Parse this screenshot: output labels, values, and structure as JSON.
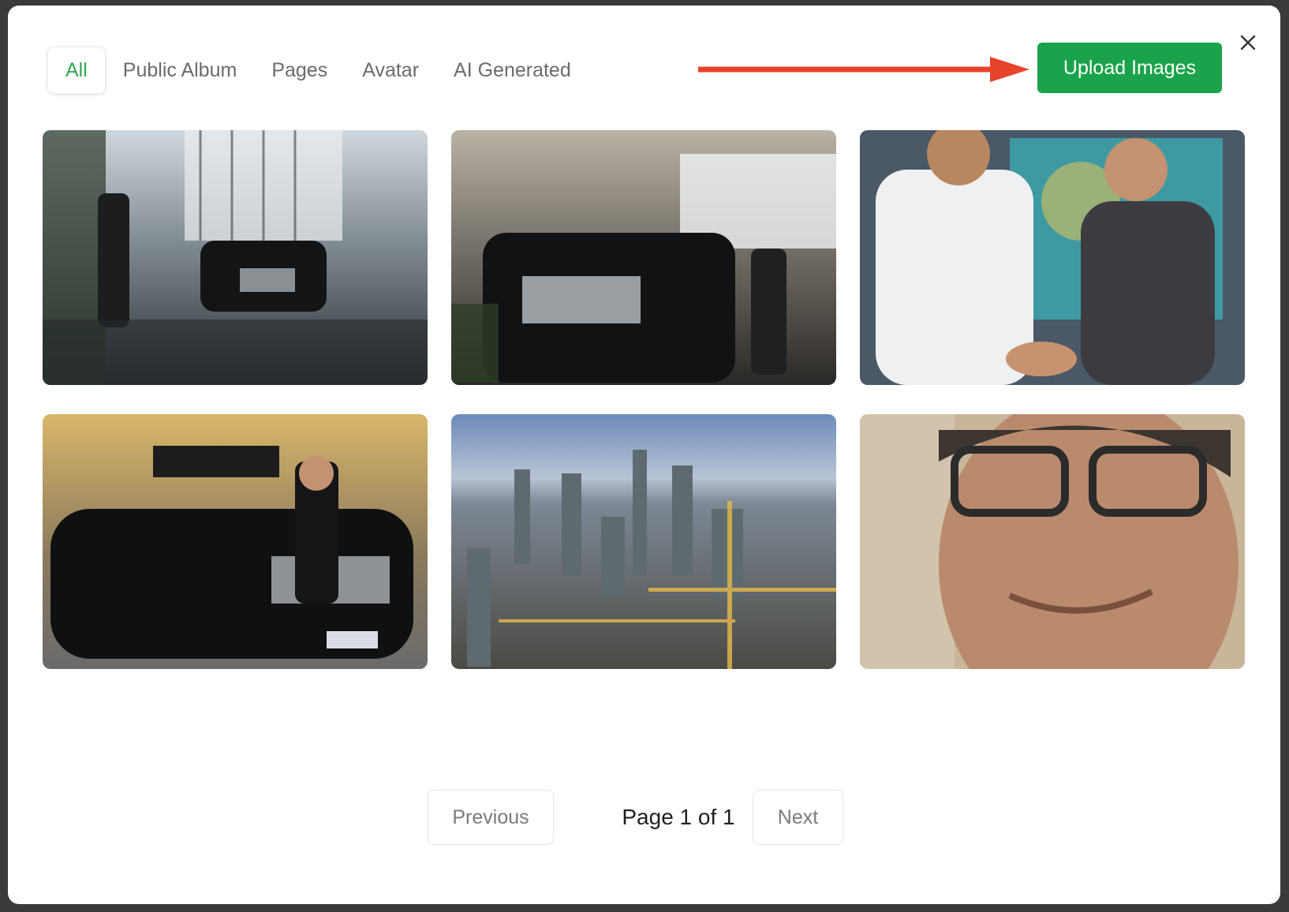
{
  "tabs": [
    {
      "label": "All",
      "active": true
    },
    {
      "label": "Public Album",
      "active": false
    },
    {
      "label": "Pages",
      "active": false
    },
    {
      "label": "Avatar",
      "active": false
    },
    {
      "label": "AI Generated",
      "active": false
    }
  ],
  "upload_button": {
    "label": "Upload Images"
  },
  "close_button": {
    "icon": "close-icon"
  },
  "annotation_arrow": {
    "color": "#e8432b"
  },
  "images": [
    {
      "subject": "black SUV in glass lobby with chauffeur"
    },
    {
      "subject": "black SUV close-up in lobby"
    },
    {
      "subject": "business handshake"
    },
    {
      "subject": "black sedan outside hotel with driver"
    },
    {
      "subject": "aerial city skyline at dusk"
    },
    {
      "subject": "smiling man with glasses portrait"
    }
  ],
  "pagination": {
    "previous_label": "Previous",
    "info": "Page 1 of 1",
    "next_label": "Next"
  },
  "colors": {
    "accent": "#1aa34a",
    "active_tab": "#2fa84f"
  }
}
